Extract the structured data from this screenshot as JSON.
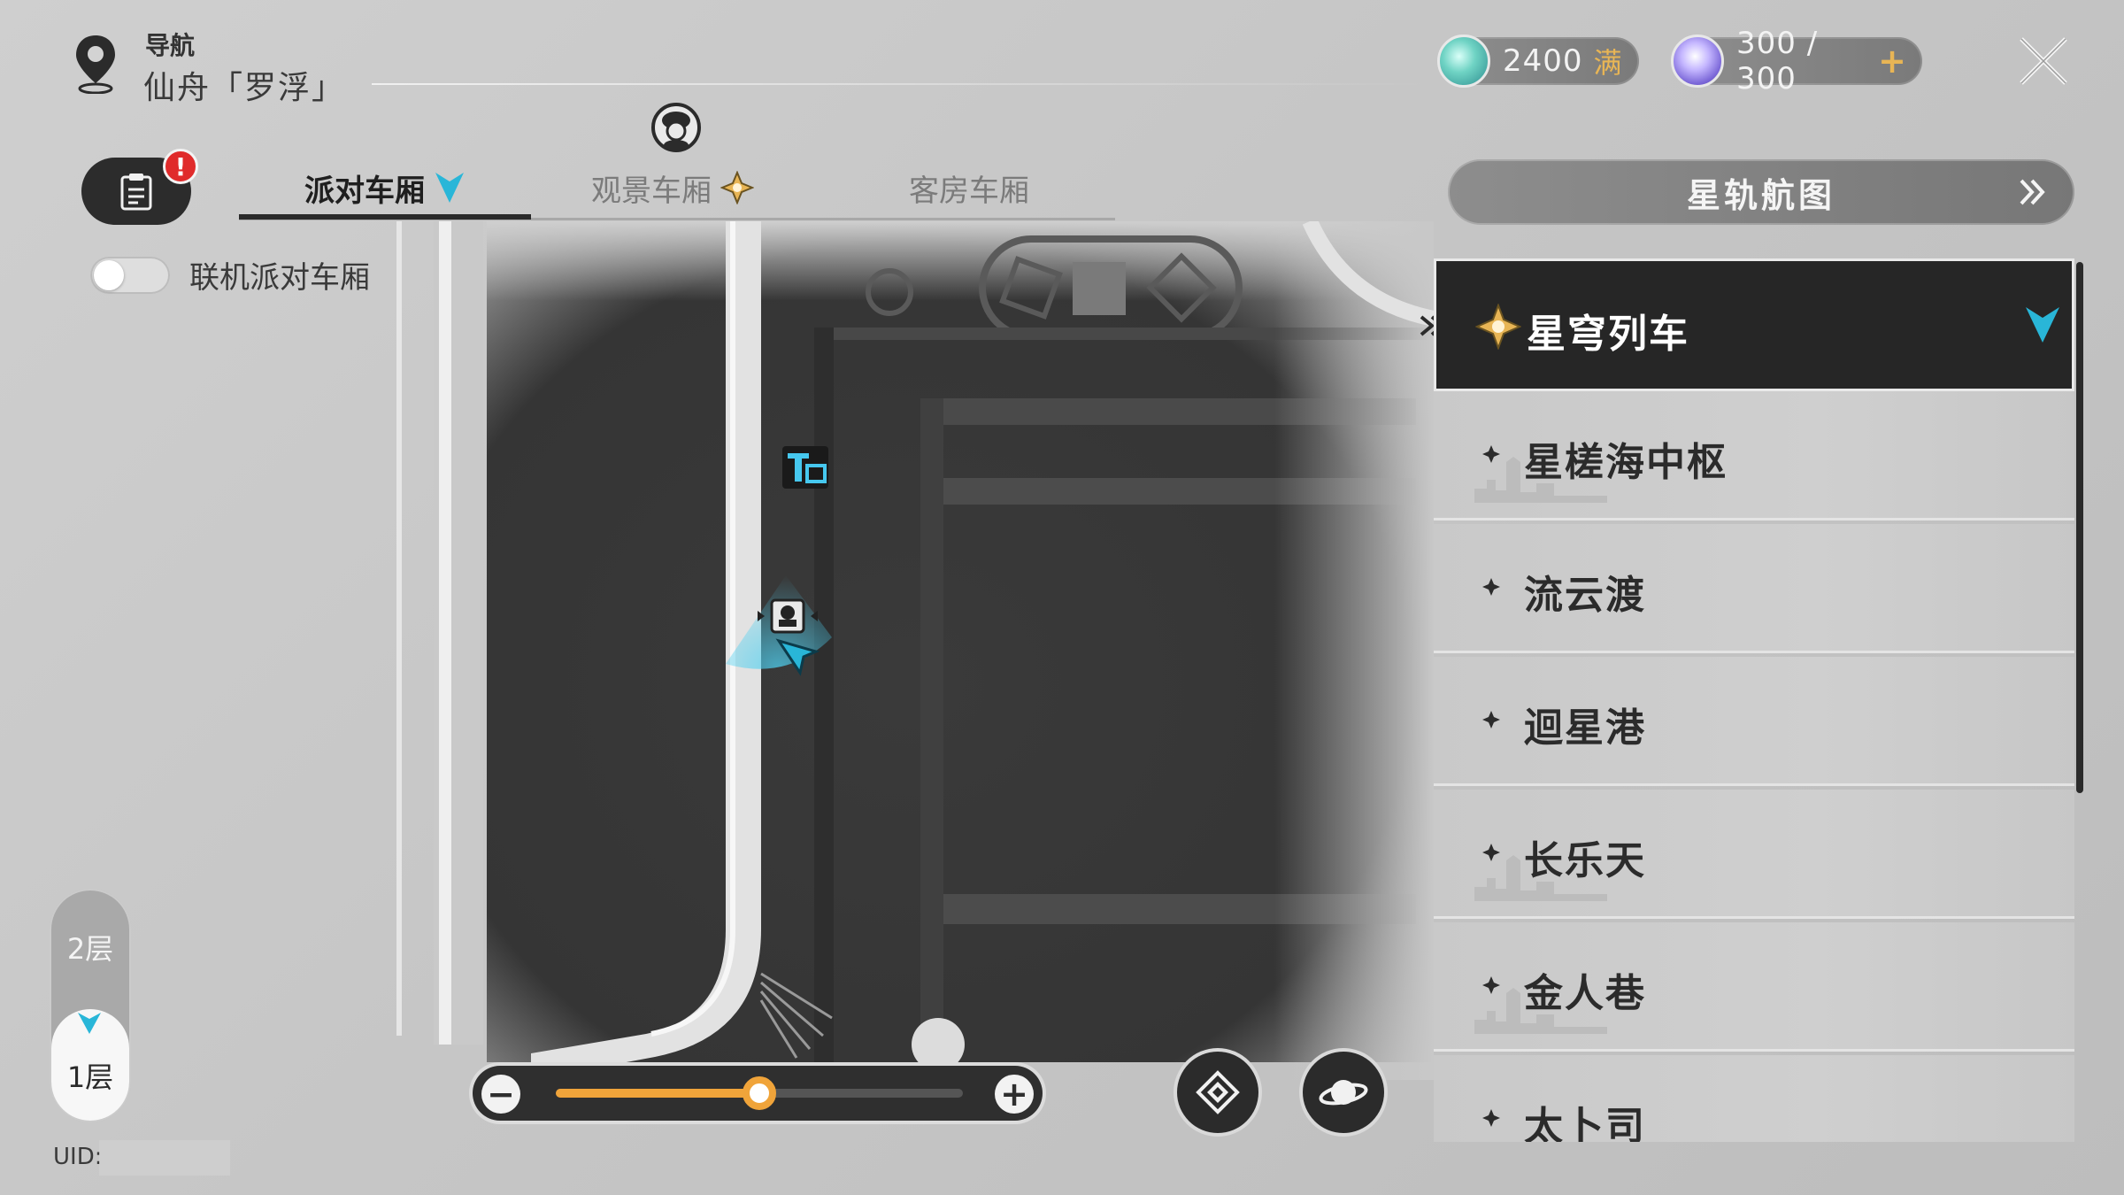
{
  "navigation": {
    "label": "导航",
    "location": "仙舟「罗浮」"
  },
  "currencies": {
    "stellar_jade": {
      "value": "2400",
      "tag": "满",
      "icon": "stellar-jade-icon"
    },
    "trailblaze_power": {
      "value": "300 / 300",
      "plus": "+",
      "icon": "trailblaze-power-icon"
    }
  },
  "mission": {
    "badge": "!"
  },
  "online_party_toggle": {
    "label": "联机派对车厢",
    "on": false
  },
  "tabs": [
    {
      "label": "派对车厢",
      "active": true
    },
    {
      "label": "观景车厢",
      "active": false
    },
    {
      "label": "客房车厢",
      "active": false
    }
  ],
  "zoom": {
    "minus": "−",
    "plus": "+",
    "level": 0.5
  },
  "floors": {
    "upper": "2层",
    "current": "1层"
  },
  "uid": {
    "label": "UID:"
  },
  "star_map": {
    "label": "星轨航图"
  },
  "locations": [
    {
      "name": "星穹列车",
      "active": true
    },
    {
      "name": "星槎海中枢",
      "active": false
    },
    {
      "name": "流云渡",
      "active": false
    },
    {
      "name": "迴星港",
      "active": false
    },
    {
      "name": "长乐天",
      "active": false
    },
    {
      "name": "金人巷",
      "active": false
    },
    {
      "name": "太卜司",
      "active": false
    }
  ],
  "colors": {
    "accent_orange": "#f0a43a",
    "accent_cyan": "#29b6d8",
    "gold": "#e8b555",
    "badge_red": "#e02b2b",
    "dark_panel": "#262626"
  }
}
